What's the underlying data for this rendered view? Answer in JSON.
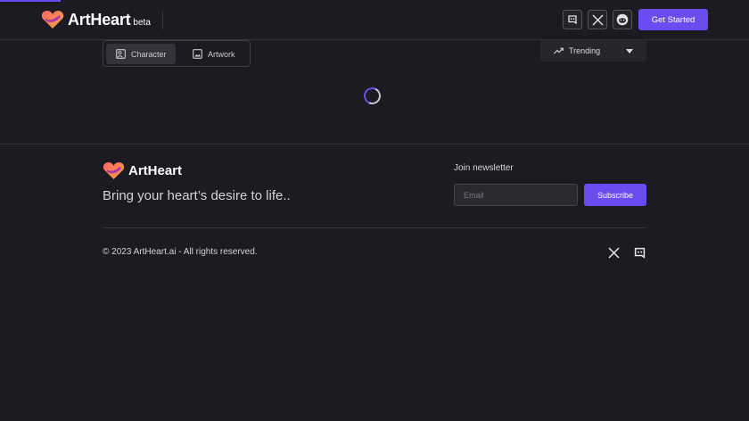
{
  "header": {
    "brand": "ArtHeart",
    "badge": "beta",
    "cta_label": "Get Started",
    "social": [
      "discord-icon",
      "x-icon",
      "reddit-icon"
    ]
  },
  "filters": {
    "tabs": [
      {
        "label": "Character",
        "icon": "character-icon",
        "active": true
      },
      {
        "label": "Artwork",
        "icon": "image-icon",
        "active": false
      }
    ],
    "sort": {
      "label": "Trending",
      "icon": "trending-icon"
    }
  },
  "footer": {
    "brand": "ArtHeart",
    "tagline": "Bring your heart’s desire to life..",
    "newsletter_title": "Join newsletter",
    "email_placeholder": "Email",
    "subscribe_label": "Subscribe",
    "copyright": "© 2023 ArtHeart.ai - All rights reserved.",
    "social": [
      "x-icon",
      "discord-icon"
    ]
  },
  "colors": {
    "background": "#1c1b21",
    "accent": "#6a4cf0",
    "border": "#34333a"
  }
}
